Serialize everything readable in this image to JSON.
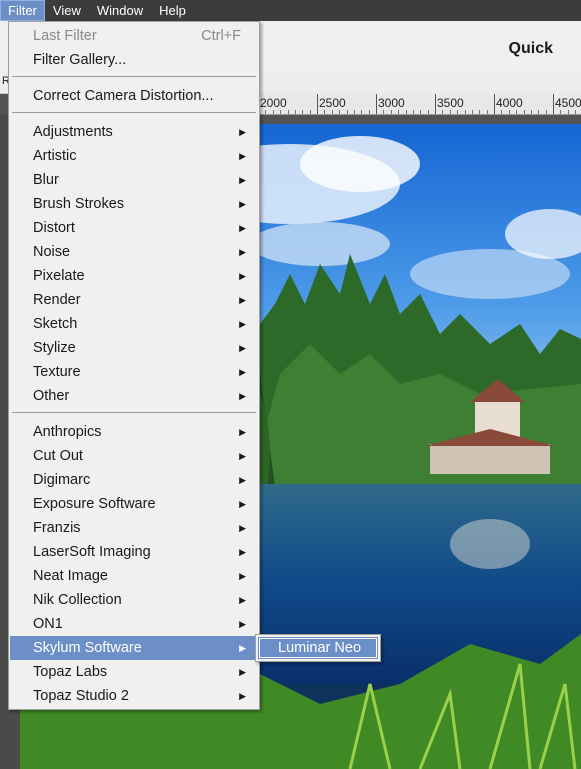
{
  "menubar": {
    "items": [
      "Filter",
      "View",
      "Window",
      "Help"
    ],
    "active_index": 0
  },
  "options_bar": {
    "mode_label": "Quick"
  },
  "toolstrip": {
    "left_letter": "R"
  },
  "ruler": {
    "labels": [
      "2000",
      "2500",
      "3000",
      "3500",
      "4000",
      "4500"
    ]
  },
  "filter_menu": {
    "items": [
      {
        "label": "Last Filter",
        "shortcut": "Ctrl+F",
        "disabled": true
      },
      {
        "label": "Filter Gallery..."
      },
      {
        "separator": true
      },
      {
        "label": "Correct Camera Distortion..."
      },
      {
        "separator": true
      },
      {
        "label": "Adjustments",
        "submenu": true
      },
      {
        "label": "Artistic",
        "submenu": true
      },
      {
        "label": "Blur",
        "submenu": true
      },
      {
        "label": "Brush Strokes",
        "submenu": true
      },
      {
        "label": "Distort",
        "submenu": true
      },
      {
        "label": "Noise",
        "submenu": true
      },
      {
        "label": "Pixelate",
        "submenu": true
      },
      {
        "label": "Render",
        "submenu": true
      },
      {
        "label": "Sketch",
        "submenu": true
      },
      {
        "label": "Stylize",
        "submenu": true
      },
      {
        "label": "Texture",
        "submenu": true
      },
      {
        "label": "Other",
        "submenu": true
      },
      {
        "separator": true
      },
      {
        "label": "Anthropics",
        "submenu": true
      },
      {
        "label": "Cut Out",
        "submenu": true
      },
      {
        "label": "Digimarc",
        "submenu": true
      },
      {
        "label": "Exposure Software",
        "submenu": true
      },
      {
        "label": "Franzis",
        "submenu": true
      },
      {
        "label": "LaserSoft Imaging",
        "submenu": true
      },
      {
        "label": "Neat Image",
        "submenu": true
      },
      {
        "label": "Nik Collection",
        "submenu": true
      },
      {
        "label": "ON1",
        "submenu": true
      },
      {
        "label": "Skylum Software",
        "submenu": true,
        "highlighted": true
      },
      {
        "label": "Topaz Labs",
        "submenu": true
      },
      {
        "label": "Topaz Studio 2",
        "submenu": true
      }
    ]
  },
  "submenu": {
    "items": [
      "Luminar Neo"
    ]
  },
  "colors": {
    "highlight": "#6c8fc7",
    "menubar": "#3c3c3c",
    "menu_bg": "#f0f0f0"
  }
}
